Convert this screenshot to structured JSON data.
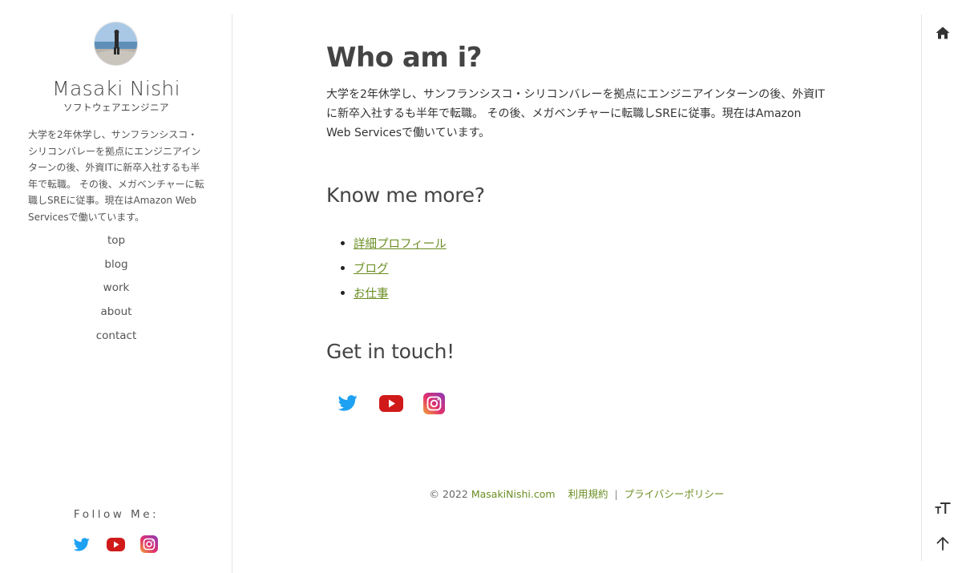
{
  "sidebar": {
    "avatar_icon": "avatar-photo",
    "title": "Masaki Nishi",
    "subtitle": "ソフトウェアエンジニア",
    "description": "大学を2年休学し、サンフランシスコ・シリコンバレーを拠点にエンジニアインターンの後、外資ITに新卒入社するも半年で転職。 その後、メガベンチャーに転職しSREに従事。現在はAmazon Web Servicesで働いています。",
    "nav": [
      {
        "label": "top"
      },
      {
        "label": "blog"
      },
      {
        "label": "work"
      },
      {
        "label": "about"
      },
      {
        "label": "contact"
      }
    ],
    "follow_label": "Follow Me:",
    "social_icons": [
      "twitter-icon",
      "youtube-icon",
      "instagram-icon"
    ]
  },
  "main": {
    "heading": "Who am i?",
    "intro": "大学を2年休学し、サンフランシスコ・シリコンバレーを拠点にエンジニアインターンの後、外資ITに新卒入社するも半年で転職。 その後、メガベンチャーに転職しSREに従事。現在はAmazon Web Servicesで働いています。",
    "know_heading": "Know me more?",
    "links": [
      {
        "label": "詳細プロフィール"
      },
      {
        "label": "ブログ"
      },
      {
        "label": "お仕事"
      }
    ],
    "contact_heading": "Get in touch!",
    "social_icons": [
      "twitter-icon",
      "youtube-icon",
      "instagram-icon"
    ]
  },
  "footer": {
    "copyright": "© 2022",
    "site_link": "MasakiNishi.com",
    "terms": "利用規約",
    "separator": "|",
    "privacy": "プライバシーポリシー"
  },
  "rail": {
    "home_icon": "home-icon",
    "font_size_icon": "font-size-icon",
    "scroll_top_icon": "arrow-up-icon"
  },
  "colors": {
    "accent": "#6b8e23",
    "twitter": "#1da1f2",
    "youtube": "#d01a1a"
  }
}
